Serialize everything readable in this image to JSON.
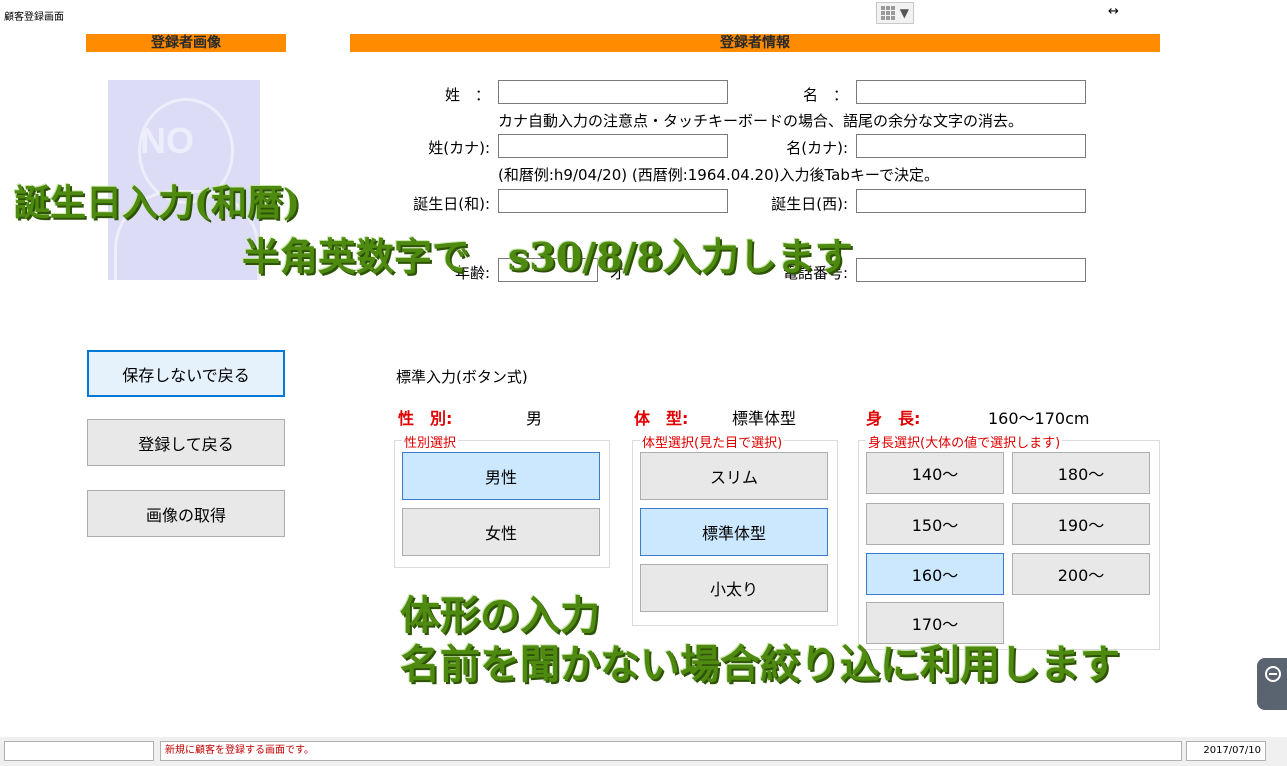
{
  "window": {
    "title": "顧客登録画面",
    "resize_glyph": "↔"
  },
  "sections": {
    "image_header": "登録者画像",
    "info_header": "登録者情報"
  },
  "photo": {
    "placeholder_text": "NO"
  },
  "form": {
    "last_name_label": "姓　：",
    "first_name_label": "名　：",
    "last_kana_label": "姓(カナ):",
    "first_kana_label": "名(カナ):",
    "kana_note": "カナ自動入力の注意点・タッチキーボードの場合、語尾の余分な文字の消去。",
    "date_note": "(和暦例:h9/04/20) (西暦例:1964.04.20)入力後Tabキーで決定。",
    "birth_wa_label": "誕生日(和):",
    "birth_sei_label": "誕生日(西):",
    "age_label": "年齢:",
    "age_unit": "才",
    "phone_label": "電話番号:"
  },
  "buttons": {
    "back_nosave": "保存しないで戻る",
    "register_back": "登録して戻る",
    "get_image": "画像の取得"
  },
  "standard_input": {
    "title": "標準入力(ボタン式)",
    "gender_label": "性　別:",
    "gender_value": "男",
    "body_label": "体　型:",
    "body_value": "標準体型",
    "height_label": "身　長:",
    "height_value": "160～170cm"
  },
  "gender_group": {
    "legend": "性別選択",
    "options": [
      "男性",
      "女性"
    ],
    "selected": "男性"
  },
  "body_group": {
    "legend": "体型選択(見た目で選択)",
    "options": [
      "スリム",
      "標準体型",
      "小太り"
    ],
    "selected": "標準体型"
  },
  "height_group": {
    "legend": "身長選択(大体の値で選択します)",
    "options": [
      "140～",
      "180～",
      "150～",
      "190～",
      "160～",
      "200～",
      "170～"
    ],
    "selected": "160～"
  },
  "overlays": {
    "birth_title": "誕生日入力(和暦)",
    "birth_hint": "半角英数字で　s30/8/8入力します",
    "body_title": "体形の入力",
    "body_hint": "名前を聞かない場合絞り込に利用します"
  },
  "status_bar": {
    "message": "新規に顧客を登録する画面です。",
    "date": "2017/07/10"
  },
  "colors": {
    "header_orange": "#ff8c00",
    "label_red": "#e00000",
    "selected_blue": "#cce8ff",
    "overlay_green": "#4f8a10"
  }
}
